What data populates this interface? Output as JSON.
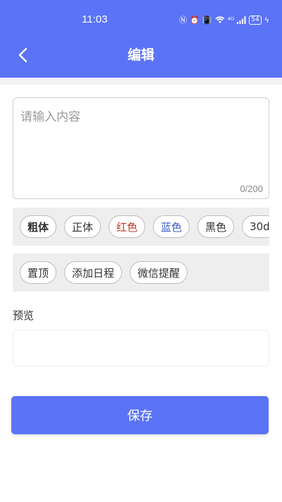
{
  "status_bar": {
    "time": "11:03",
    "signal_text": "⁴ᴳ",
    "battery": "54"
  },
  "header": {
    "title": "编辑",
    "bg_color": "#5b73f7"
  },
  "editor": {
    "placeholder": "请输入内容",
    "value": "",
    "counter": "0/200"
  },
  "format_chips": [
    {
      "label": "粗体",
      "color": "#333333"
    },
    {
      "label": "正体",
      "color": "#333333"
    },
    {
      "label": "红色",
      "color": "#c0392b"
    },
    {
      "label": "蓝色",
      "color": "#3f5fc8"
    },
    {
      "label": "黑色",
      "color": "#333333"
    },
    {
      "label": "30d",
      "color": "#333333"
    }
  ],
  "action_chips": [
    {
      "label": "置顶"
    },
    {
      "label": "添加日程"
    },
    {
      "label": "微信提醒"
    }
  ],
  "preview": {
    "label": "预览",
    "content": ""
  },
  "save_button": {
    "label": "保存",
    "color": "#5b73f7"
  }
}
